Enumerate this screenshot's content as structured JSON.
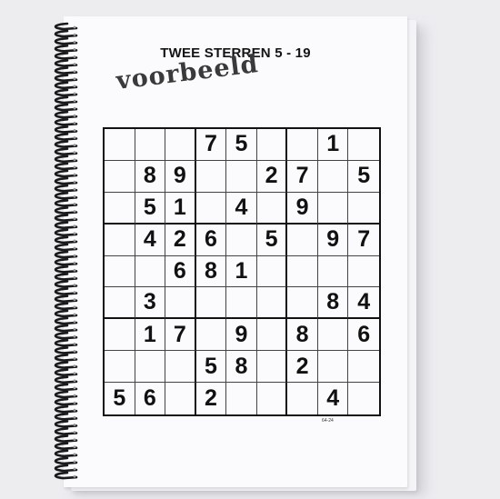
{
  "title": "TWEE STERREN 5 - 19",
  "stamp": "voorbeeld",
  "page_code": "64-24",
  "grid": [
    [
      "",
      "",
      "",
      "7",
      "5",
      "",
      "",
      "1",
      ""
    ],
    [
      "",
      "8",
      "9",
      "",
      "",
      "2",
      "7",
      "",
      "5"
    ],
    [
      "",
      "5",
      "1",
      "",
      "4",
      "",
      "9",
      "",
      ""
    ],
    [
      "",
      "4",
      "2",
      "6",
      "",
      "5",
      "",
      "9",
      "7"
    ],
    [
      "",
      "",
      "6",
      "8",
      "1",
      "",
      "",
      "",
      ""
    ],
    [
      "",
      "3",
      "",
      "",
      "",
      "",
      "",
      "8",
      "4"
    ],
    [
      "",
      "1",
      "7",
      "",
      "9",
      "",
      "8",
      "",
      "6"
    ],
    [
      "",
      "",
      "",
      "5",
      "8",
      "",
      "2",
      "",
      ""
    ],
    [
      "5",
      "6",
      "",
      "2",
      "",
      "",
      "",
      "4",
      ""
    ]
  ]
}
